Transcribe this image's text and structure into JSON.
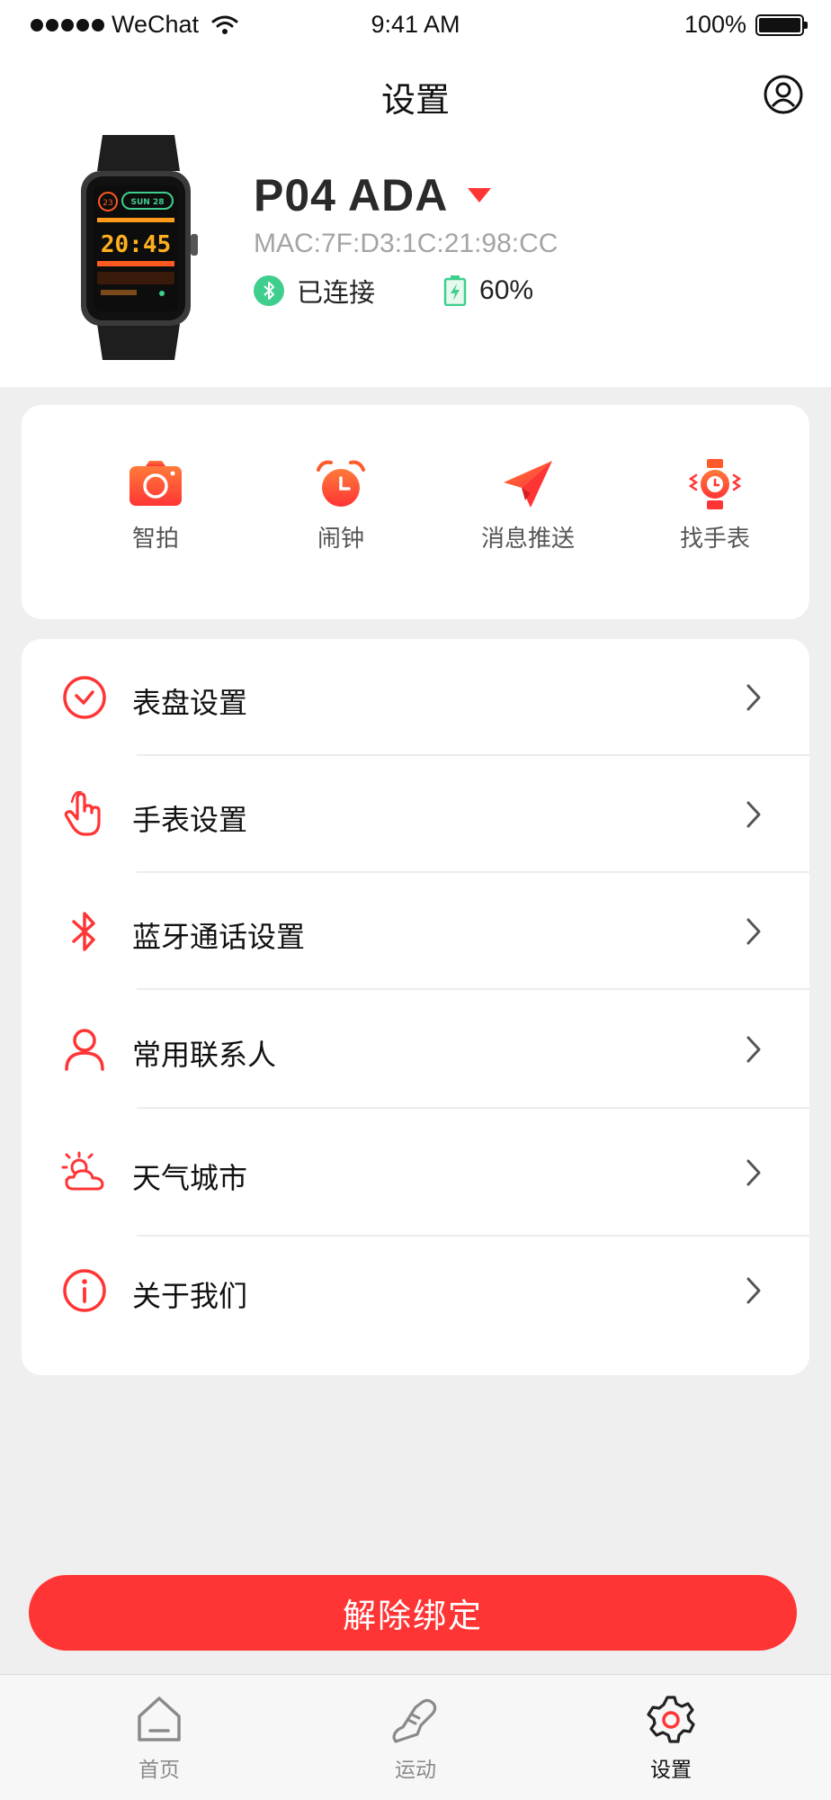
{
  "status_bar": {
    "carrier": "WeChat",
    "time": "9:41 AM",
    "battery": "100%"
  },
  "header": {
    "title": "设置"
  },
  "device": {
    "name": "P04 ADA",
    "mac": "MAC:7F:D3:1C:21:98:CC",
    "connection_status": "已连接",
    "battery": "60%",
    "watch_face": {
      "time": "20:45",
      "date": "SUN 28",
      "badge": "23"
    }
  },
  "quick_actions": [
    {
      "label": "智拍",
      "icon": "camera-icon"
    },
    {
      "label": "闹钟",
      "icon": "alarm-clock-icon"
    },
    {
      "label": "消息推送",
      "icon": "paper-plane-icon"
    },
    {
      "label": "找手表",
      "icon": "find-watch-icon"
    }
  ],
  "settings_list": [
    {
      "label": "表盘设置",
      "icon": "watch-face-icon"
    },
    {
      "label": "手表设置",
      "icon": "touch-hand-icon"
    },
    {
      "label": "蓝牙通话设置",
      "icon": "bluetooth-icon"
    },
    {
      "label": "常用联系人",
      "icon": "contact-person-icon"
    },
    {
      "label": "天气城市",
      "icon": "weather-sun-cloud-icon"
    },
    {
      "label": "关于我们",
      "icon": "info-icon"
    }
  ],
  "unbind_button": {
    "label": "解除绑定"
  },
  "tab_bar": {
    "tabs": [
      {
        "label": "首页",
        "icon": "home-icon",
        "active": false
      },
      {
        "label": "运动",
        "icon": "running-shoe-icon",
        "active": false
      },
      {
        "label": "设置",
        "icon": "gear-icon",
        "active": true
      }
    ]
  },
  "colors": {
    "accent": "#ff3535",
    "connected": "#3ecf8e",
    "page_background": "#efefef"
  }
}
